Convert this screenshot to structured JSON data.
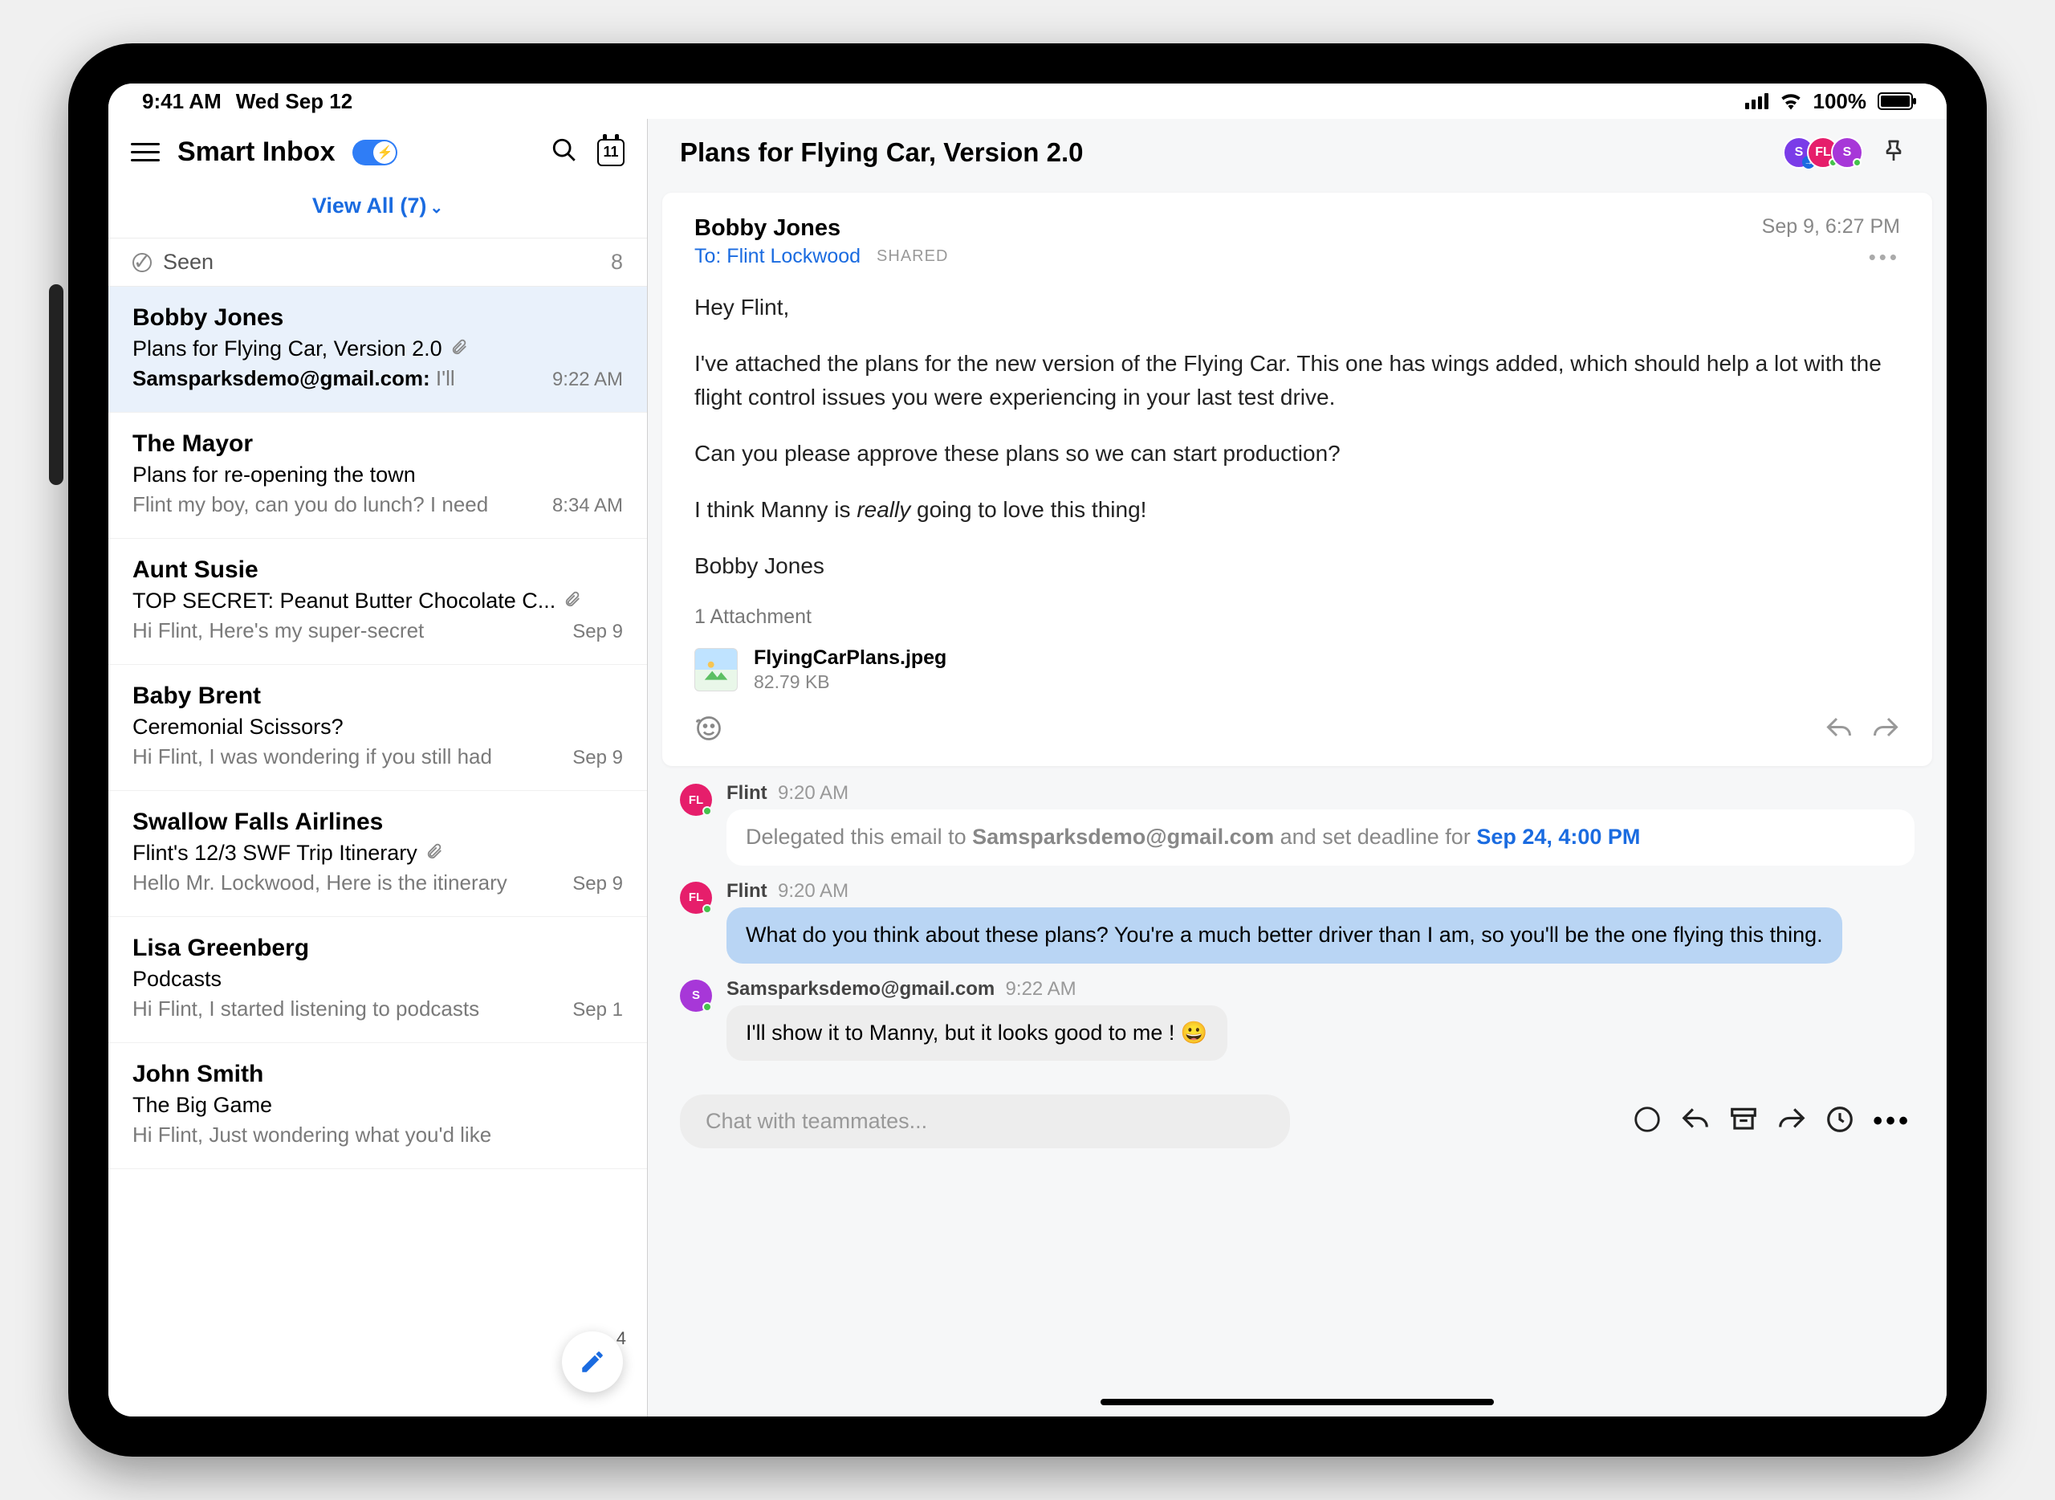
{
  "statusbar": {
    "time": "9:41 AM",
    "date": "Wed Sep 12",
    "battery_pct": "100%"
  },
  "sidebar": {
    "title": "Smart Inbox",
    "calendar_day": "11",
    "view_all_label": "View All (7)",
    "seen_label": "Seen",
    "seen_count": "8",
    "emails": [
      {
        "sender": "Bobby Jones",
        "subject": "Plans for Flying Car, Version 2.0",
        "preview_prefix": "Samsparksdemo@gmail.com:",
        "preview": "I'll",
        "time": "9:22 AM",
        "attach": true,
        "selected": true
      },
      {
        "sender": "The Mayor",
        "subject": "Plans for re-opening the town",
        "preview_prefix": "",
        "preview": "Flint my boy, can you do lunch? I need",
        "time": "8:34 AM",
        "attach": false,
        "selected": false
      },
      {
        "sender": "Aunt Susie",
        "subject": "TOP SECRET: Peanut Butter Chocolate C...",
        "preview_prefix": "",
        "preview": "Hi Flint, Here's my super-secret",
        "time": "Sep 9",
        "attach": true,
        "selected": false
      },
      {
        "sender": "Baby Brent",
        "subject": "Ceremonial Scissors?",
        "preview_prefix": "",
        "preview": "Hi Flint, I was wondering if you still had",
        "time": "Sep 9",
        "attach": false,
        "selected": false
      },
      {
        "sender": "Swallow Falls Airlines",
        "subject": "Flint's 12/3 SWF Trip Itinerary",
        "preview_prefix": "",
        "preview": "Hello Mr. Lockwood, Here is the itinerary",
        "time": "Sep 9",
        "attach": true,
        "selected": false
      },
      {
        "sender": "Lisa Greenberg",
        "subject": "Podcasts",
        "preview_prefix": "",
        "preview": "Hi Flint, I started listening to podcasts",
        "time": "Sep 1",
        "attach": false,
        "selected": false
      },
      {
        "sender": "John Smith",
        "subject": "The Big Game",
        "preview_prefix": "",
        "preview": "Hi Flint, Just wondering what you'd like",
        "time": "",
        "attach": false,
        "selected": false
      }
    ],
    "fab_badge": "4"
  },
  "thread": {
    "title": "Plans for Flying Car, Version 2.0",
    "avatars": [
      {
        "label": "S",
        "color": "#7a3ce8",
        "arrow": true
      },
      {
        "label": "FL",
        "color": "#e61e6b",
        "arrow": false
      },
      {
        "label": "S",
        "color": "#a737d8",
        "arrow": false
      }
    ],
    "message": {
      "from": "Bobby Jones",
      "to_label": "To: Flint Lockwood",
      "shared": "SHARED",
      "date": "Sep 9, 6:27 PM",
      "body_html": "Hey Flint,|I've attached the plans for the new version of the Flying Car. This one has wings added, which should help a lot with the flight control issues you were experiencing in your last test drive.|Can you please approve these plans so we can start production?|I think Manny is <em>really</em> going to love this thing!|Bobby Jones",
      "attachment_count_label": "1 Attachment",
      "attachment_name": "FlyingCarPlans.jpeg",
      "attachment_size": "82.79 KB"
    },
    "chat": [
      {
        "author": "Flint",
        "time": "9:20 AM",
        "avatar_color": "#e61e6b",
        "avatar_label": "FL",
        "type": "system",
        "text_before": "Delegated this email to ",
        "bold": "Samsparksdemo@gmail.com",
        "text_mid": " and set deadline for ",
        "link": "Sep 24, 4:00 PM"
      },
      {
        "author": "Flint",
        "time": "9:20 AM",
        "avatar_color": "#e61e6b",
        "avatar_label": "FL",
        "type": "blue",
        "text": "What do you think about these plans? You're a much better driver than I am, so you'll be the one flying this thing."
      },
      {
        "author": "Samsparksdemo@gmail.com",
        "time": "9:22 AM",
        "avatar_color": "#a737d8",
        "avatar_label": "S",
        "type": "gray",
        "text": "I'll show it to Manny, but it looks good to me ! 😀"
      }
    ],
    "chat_input_placeholder": "Chat with teammates..."
  }
}
